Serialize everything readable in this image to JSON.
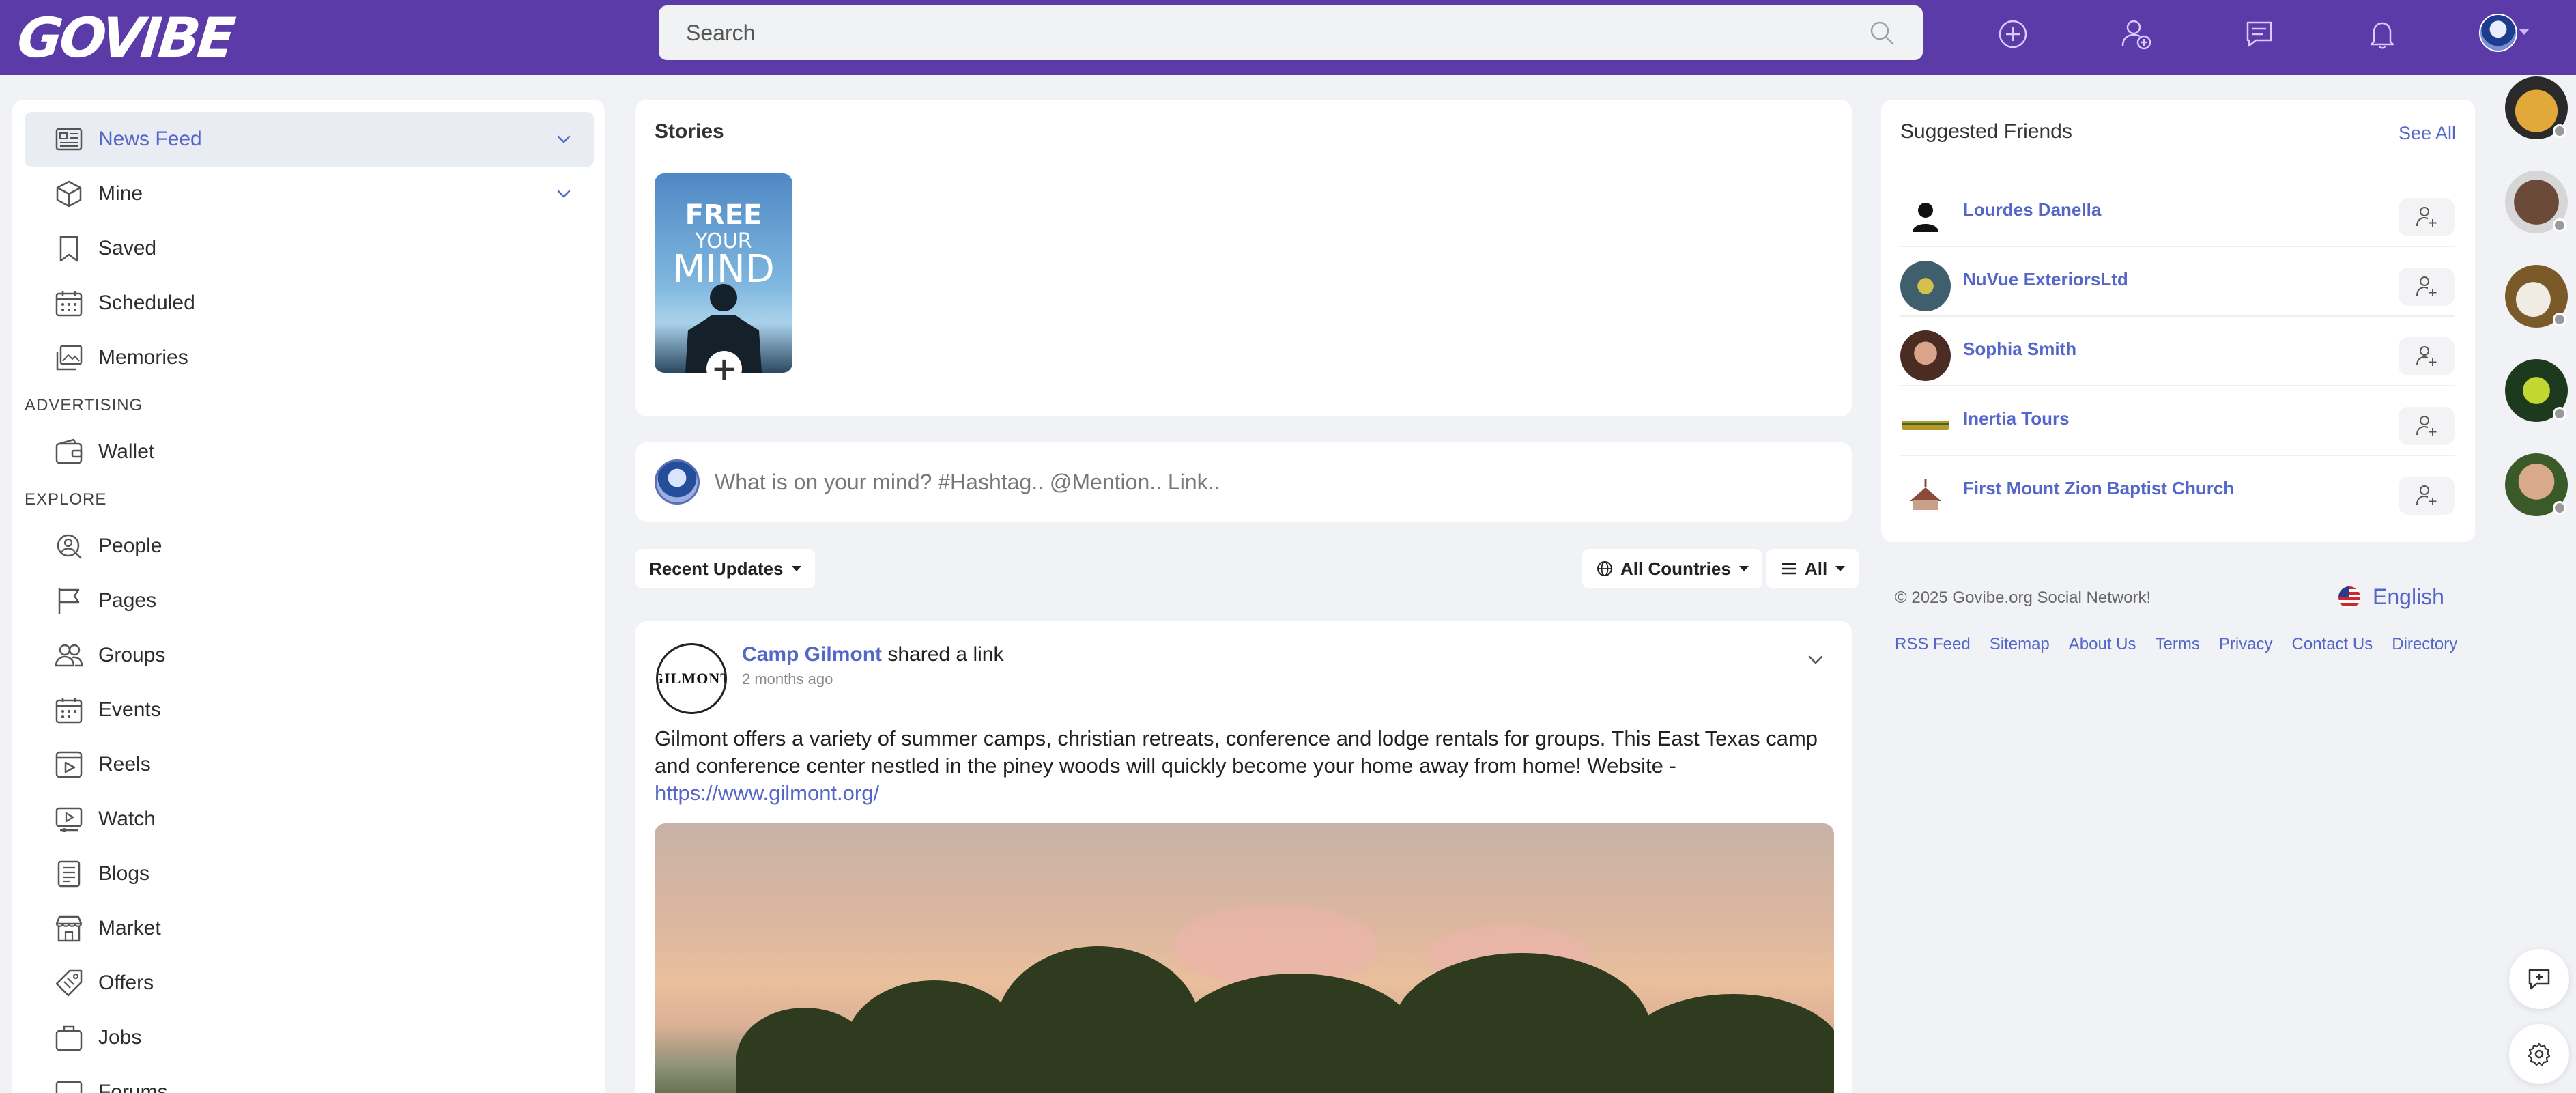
{
  "header": {
    "logo_text": "GOVIBE",
    "search_placeholder": "Search",
    "icons": [
      "search-icon",
      "create-plus-icon",
      "add-friend-icon",
      "messages-icon",
      "notifications-bell-icon",
      "user-avatar"
    ]
  },
  "sidebar": {
    "items": [
      {
        "label": "News Feed",
        "icon": "newspaper-icon",
        "active": true,
        "expandable": true
      },
      {
        "label": "Mine",
        "icon": "cube-icon",
        "expandable": true
      },
      {
        "label": "Saved",
        "icon": "bookmark-icon"
      },
      {
        "label": "Scheduled",
        "icon": "calendar-clock-icon"
      },
      {
        "label": "Memories",
        "icon": "memories-icon"
      }
    ],
    "section_advertising": "ADVERTISING",
    "advertising_items": [
      {
        "label": "Wallet",
        "icon": "wallet-icon"
      }
    ],
    "section_explore": "EXPLORE",
    "explore_items": [
      {
        "label": "People",
        "icon": "people-search-icon"
      },
      {
        "label": "Pages",
        "icon": "flag-icon"
      },
      {
        "label": "Groups",
        "icon": "groups-icon"
      },
      {
        "label": "Events",
        "icon": "calendar-icon"
      },
      {
        "label": "Reels",
        "icon": "reels-icon"
      },
      {
        "label": "Watch",
        "icon": "watch-icon"
      },
      {
        "label": "Blogs",
        "icon": "blog-icon"
      },
      {
        "label": "Market",
        "icon": "store-icon"
      },
      {
        "label": "Offers",
        "icon": "tag-icon"
      },
      {
        "label": "Jobs",
        "icon": "briefcase-icon"
      },
      {
        "label": "Forums",
        "icon": "forum-icon"
      }
    ]
  },
  "stories": {
    "title": "Stories",
    "story_art_lines": [
      "FREE",
      "YOUR",
      "MIND"
    ]
  },
  "composer": {
    "placeholder": "What is on your mind? #Hashtag.. @Mention.. Link.."
  },
  "filters": {
    "sort_label": "Recent Updates",
    "country_label": "All Countries",
    "type_label": "All"
  },
  "post": {
    "author": "Camp Gilmont",
    "action": "shared a link",
    "time": "2 months ago",
    "logo_text": "GILMONT",
    "body_text": "Gilmont offers a variety of summer camps, christian retreats, conference and lodge rentals for groups. This East Texas camp and conference center nestled in the piney woods will quickly become your home away from home! Website - ",
    "link": "https://www.gilmont.org/"
  },
  "suggested": {
    "title": "Suggested Friends",
    "see_all": "See All",
    "friends": [
      {
        "name": "Lourdes Danella"
      },
      {
        "name": "NuVue ExteriorsLtd"
      },
      {
        "name": "Sophia Smith"
      },
      {
        "name": "Inertia Tours"
      },
      {
        "name": "First Mount Zion Baptist Church"
      }
    ]
  },
  "footer": {
    "copyright": "© 2025 Govibe.org Social Network!",
    "language": "English",
    "links": [
      "RSS Feed",
      "Sitemap",
      "About Us",
      "Terms",
      "Privacy",
      "Contact Us",
      "Directory"
    ]
  },
  "colors": {
    "brand": "#5b3ba8",
    "link": "#5467c9",
    "background": "#f0f2f5"
  }
}
